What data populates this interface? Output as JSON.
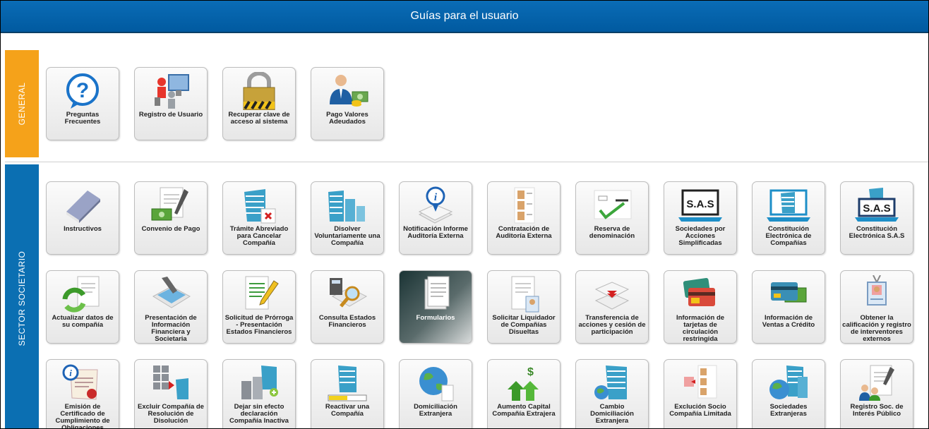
{
  "header": {
    "title": "Guías para el usuario"
  },
  "sections": [
    {
      "label": "GENERAL"
    },
    {
      "label": "SECTOR SOCIETARIO"
    }
  ],
  "tiles": [
    {
      "label": "Preguntas Frecuentes",
      "icon": "question-mark-icon"
    },
    {
      "label": "Registro de Usuario",
      "icon": "users-computer-icon"
    },
    {
      "label": "Recuperar clave de acceso al sistema",
      "icon": "padlock-icon"
    },
    {
      "label": "Pago Valores Adeudados",
      "icon": "person-money-icon"
    },
    {
      "label": "Instructivos",
      "icon": "book-icon"
    },
    {
      "label": "Convenio de Pago",
      "icon": "document-money-icon"
    },
    {
      "label": "Trámite Abreviado para Cancelar Compañía",
      "icon": "building-cancel-icon"
    },
    {
      "label": "Disolver Voluntariamente una Compañía",
      "icon": "buildings-icon"
    },
    {
      "label": "Notificación Informe Auditoría Externa",
      "icon": "info-papers-icon"
    },
    {
      "label": "Contratación de Auditoría Externa",
      "icon": "id-cards-icon"
    },
    {
      "label": "Reserva de denominación",
      "icon": "check-card-icon"
    },
    {
      "label": "Sociedades por Acciones Simplificadas",
      "icon": "sas-laptop-icon"
    },
    {
      "label": "Constitución Electrónica de Compañías",
      "icon": "laptop-building-icon"
    },
    {
      "label": "Constitución Electrónica S.A.S",
      "icon": "sas-laptop-building-icon"
    },
    {
      "label": "Actualizar datos de su compañía",
      "icon": "refresh-document-icon"
    },
    {
      "label": "Presentación de Información Financiera y Societaria",
      "icon": "upload-documents-icon"
    },
    {
      "label": "Solicitud de Prórroga - Presentación Estados Financieros",
      "icon": "document-pen-icon"
    },
    {
      "label": "Consulta Estados Financieros",
      "icon": "calculator-search-icon"
    },
    {
      "label": "Formularios",
      "icon": "forms-icon"
    },
    {
      "label": "Solicitar Liquidador de Compañías Disueltas",
      "icon": "document-badge-icon"
    },
    {
      "label": "Transferencia de acciones y cesión de participación",
      "icon": "transfer-papers-icon"
    },
    {
      "label": "Información de tarjetas de circulación restringida",
      "icon": "credit-cards-icon"
    },
    {
      "label": "Información de Ventas a Crédito",
      "icon": "credit-card-money-icon"
    },
    {
      "label": "Obtener la calificación y registro de interventores externos",
      "icon": "id-badge-icon"
    },
    {
      "label": "Emisión de Certificado de Cumplimiento de Obligaciones",
      "icon": "certificate-icon"
    },
    {
      "label": "Excluir Compañía de Resolución de Disolución",
      "icon": "buildings-arrow-icon"
    },
    {
      "label": "Dejar sin efecto declaración Compañía Inactiva",
      "icon": "buildings-add-icon"
    },
    {
      "label": "Reactivar una Compañía",
      "icon": "building-progress-icon"
    },
    {
      "label": "Domiciliación Extranjera",
      "icon": "globe-document-icon"
    },
    {
      "label": "Aumento Capital Compañía Extrajera",
      "icon": "money-arrows-up-icon"
    },
    {
      "label": "Cambio Domiciliación Extranjera",
      "icon": "building-globe-icon"
    },
    {
      "label": "Exclución Socio Compañía Limitada",
      "icon": "remove-partner-icon"
    },
    {
      "label": "Sociedades Extranjeras",
      "icon": "globe-buildings-icon"
    },
    {
      "label": "Registro Soc. de Interés Público",
      "icon": "document-people-icon"
    }
  ]
}
